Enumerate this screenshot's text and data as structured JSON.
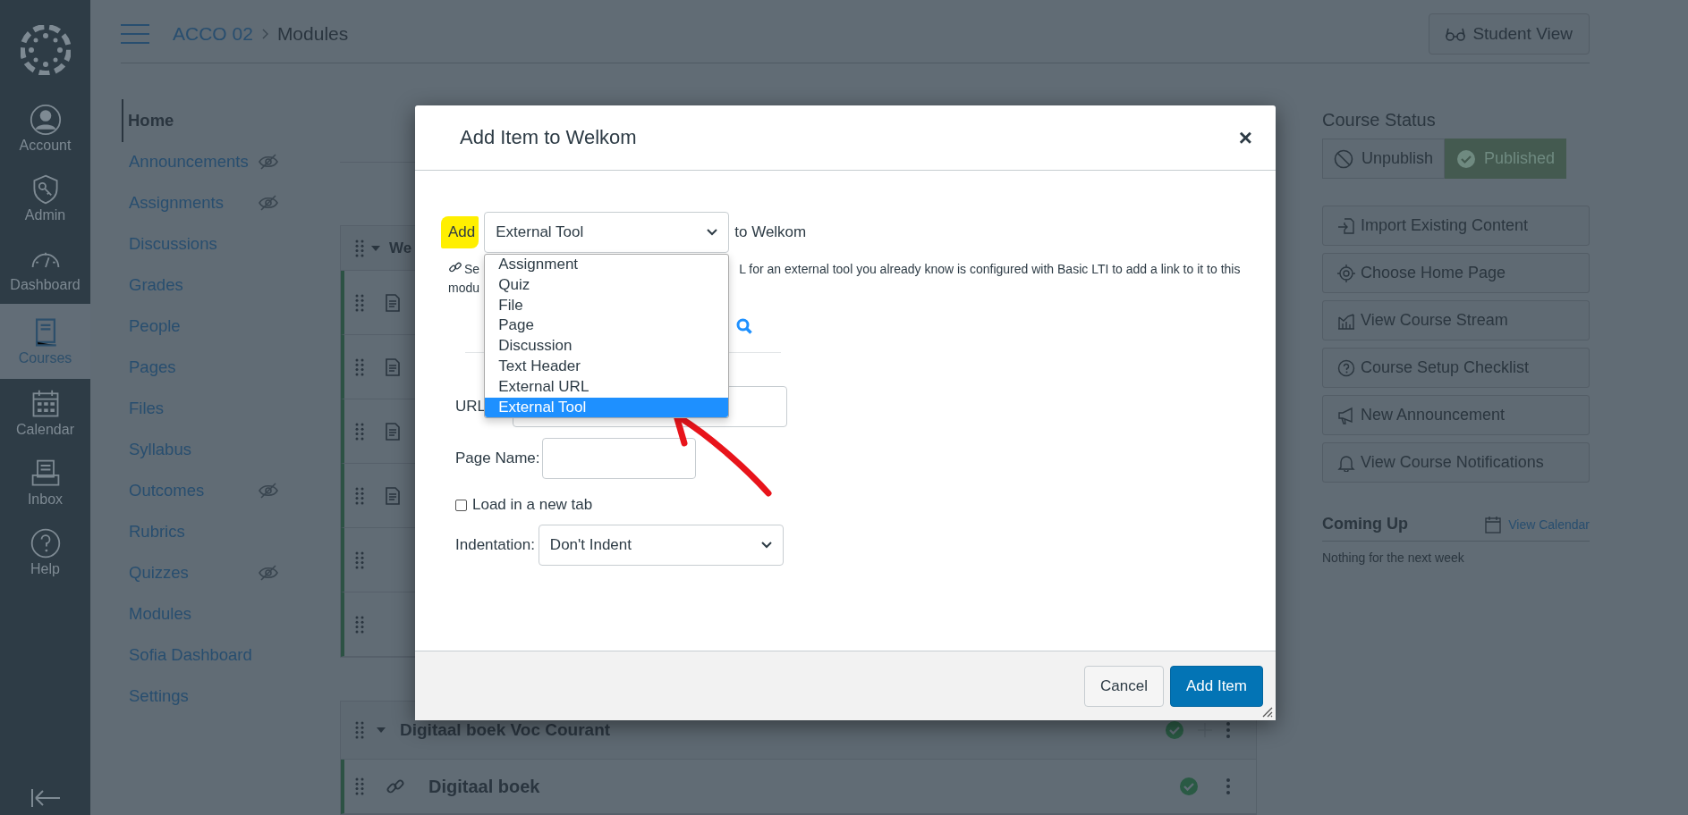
{
  "global_nav": {
    "items": [
      {
        "label": "Account",
        "selected": false
      },
      {
        "label": "Admin",
        "selected": false
      },
      {
        "label": "Dashboard",
        "selected": false
      },
      {
        "label": "Courses",
        "selected": true
      },
      {
        "label": "Calendar",
        "selected": false
      },
      {
        "label": "Inbox",
        "selected": false
      },
      {
        "label": "Help",
        "selected": false
      }
    ]
  },
  "breadcrumb": [
    "ACCO 02",
    "Modules"
  ],
  "student_view_button": "Student View",
  "course_nav": [
    {
      "label": "Home",
      "selected": true,
      "hidden": false
    },
    {
      "label": "Announcements",
      "selected": false,
      "hidden": true
    },
    {
      "label": "Assignments",
      "selected": false,
      "hidden": true
    },
    {
      "label": "Discussions",
      "selected": false,
      "hidden": false
    },
    {
      "label": "Grades",
      "selected": false,
      "hidden": false
    },
    {
      "label": "People",
      "selected": false,
      "hidden": false
    },
    {
      "label": "Pages",
      "selected": false,
      "hidden": false
    },
    {
      "label": "Files",
      "selected": false,
      "hidden": false
    },
    {
      "label": "Syllabus",
      "selected": false,
      "hidden": false
    },
    {
      "label": "Outcomes",
      "selected": false,
      "hidden": true
    },
    {
      "label": "Rubrics",
      "selected": false,
      "hidden": false
    },
    {
      "label": "Quizzes",
      "selected": false,
      "hidden": true
    },
    {
      "label": "Modules",
      "selected": false,
      "hidden": false
    },
    {
      "label": "Sofia Dashboard",
      "selected": false,
      "hidden": false
    },
    {
      "label": "Settings",
      "selected": false,
      "hidden": false
    }
  ],
  "modules": [
    {
      "title": "We",
      "expanded": true,
      "items": [
        {
          "kind": "page"
        },
        {
          "kind": "page"
        },
        {
          "kind": "page"
        },
        {
          "kind": "page"
        },
        {
          "kind": "header"
        },
        {
          "kind": "header"
        }
      ]
    },
    {
      "title": "Digitaal boek Voc Courant",
      "expanded": true,
      "published": true,
      "items": [
        {
          "kind": "link",
          "title": "Digitaal boek",
          "published": true
        }
      ]
    }
  ],
  "course_status": {
    "heading": "Course Status",
    "unpublish": "Unpublish",
    "published": "Published",
    "is_published": true
  },
  "sidebar_buttons": [
    "Import Existing Content",
    "Choose Home Page",
    "View Course Stream",
    "Course Setup Checklist",
    "New Announcement",
    "View Course Notifications"
  ],
  "coming_up": {
    "heading": "Coming Up",
    "link": "View Calendar",
    "empty": "Nothing for the next week"
  },
  "modal": {
    "title": "Add Item to Welkom",
    "close": "×",
    "add_label": "Add",
    "select_value": "External Tool",
    "to_label": "to Welkom",
    "options": [
      {
        "label": "Assignment",
        "selected": false
      },
      {
        "label": "Quiz",
        "selected": false
      },
      {
        "label": "File",
        "selected": false
      },
      {
        "label": "Page",
        "selected": false
      },
      {
        "label": "Discussion",
        "selected": false
      },
      {
        "label": "Text Header",
        "selected": false
      },
      {
        "label": "External URL",
        "selected": false
      },
      {
        "label": "External Tool",
        "selected": true
      }
    ],
    "description_parts": [
      "Se",
      "L for an external tool you already know is configured with Basic LTI to add a link to it to this",
      "modu"
    ],
    "url_label": "URL",
    "page_name_label": "Page Name:",
    "new_tab": {
      "label": "Load in a new tab",
      "checked": false
    },
    "indentation_label": "Indentation:",
    "indentation_value": "Don't Indent",
    "cancel": "Cancel",
    "submit": "Add Item"
  }
}
